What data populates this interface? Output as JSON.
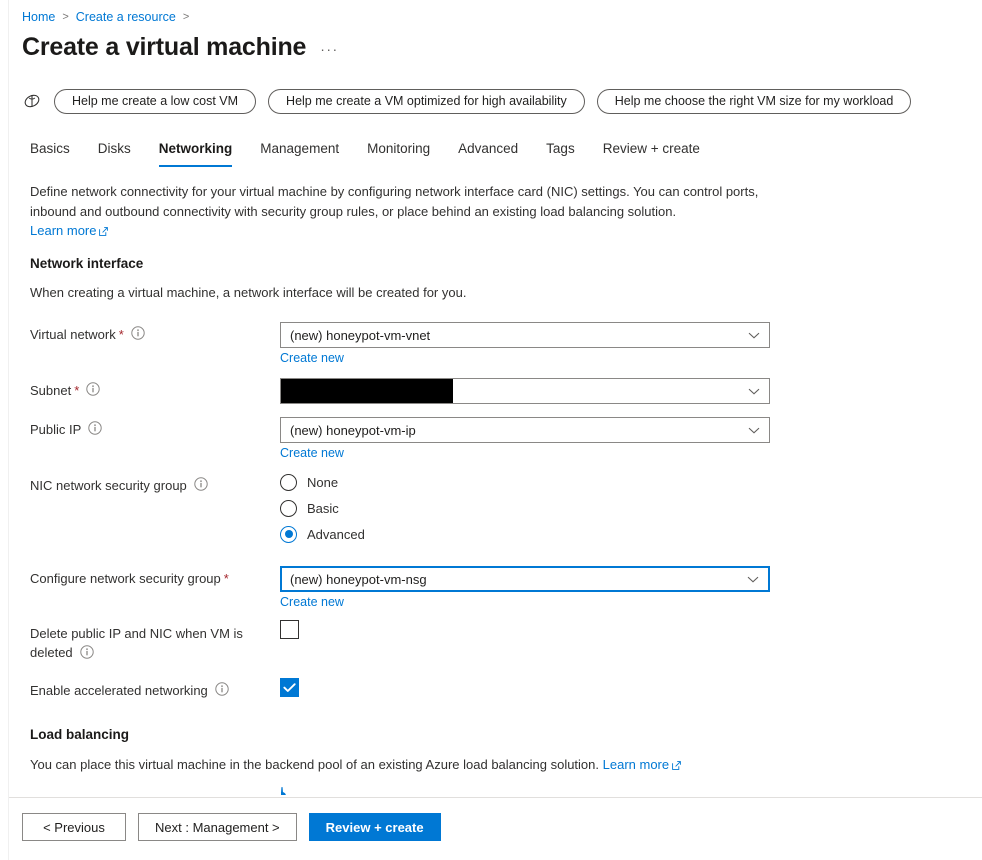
{
  "breadcrumb": {
    "items": [
      {
        "label": "Home"
      },
      {
        "label": "Create a resource"
      }
    ],
    "separator": ">"
  },
  "header": {
    "title": "Create a virtual machine",
    "ellipsis": "···"
  },
  "copilot": {
    "icon": "copilot-icon",
    "pills": [
      {
        "label": "Help me create a low cost VM"
      },
      {
        "label": "Help me create a VM optimized for high availability"
      },
      {
        "label": "Help me choose the right VM size for my workload"
      }
    ]
  },
  "tabs": [
    {
      "label": "Basics",
      "active": false
    },
    {
      "label": "Disks",
      "active": false
    },
    {
      "label": "Networking",
      "active": true
    },
    {
      "label": "Management",
      "active": false
    },
    {
      "label": "Monitoring",
      "active": false
    },
    {
      "label": "Advanced",
      "active": false
    },
    {
      "label": "Tags",
      "active": false
    },
    {
      "label": "Review + create",
      "active": false
    }
  ],
  "description": {
    "line1": "Define network connectivity for your virtual machine by configuring network interface card (NIC) settings. You can control ports,",
    "line2": "inbound and outbound connectivity with security group rules, or place behind an existing load balancing solution.",
    "learn_more": "Learn more"
  },
  "network_interface": {
    "heading": "Network interface",
    "subtext": "When creating a virtual machine, a network interface will be created for you.",
    "virtual_network": {
      "label": "Virtual network",
      "required": "*",
      "value": "(new) honeypot-vm-vnet",
      "create_new": "Create new"
    },
    "subnet": {
      "label": "Subnet",
      "required": "*",
      "value": "",
      "redacted": true
    },
    "public_ip": {
      "label": "Public IP",
      "value": "(new) honeypot-vm-ip",
      "create_new": "Create new"
    },
    "nic_nsg": {
      "label": "NIC network security group",
      "options": [
        {
          "label": "None",
          "selected": false
        },
        {
          "label": "Basic",
          "selected": false
        },
        {
          "label": "Advanced",
          "selected": true
        }
      ]
    },
    "configure_nsg": {
      "label": "Configure network security group",
      "required": "*",
      "value": "(new) honeypot-vm-nsg",
      "create_new": "Create new",
      "focused": true
    },
    "delete_public_ip": {
      "label_line1": "Delete public IP and NIC when VM is",
      "label_line2": "deleted",
      "checked": false
    },
    "accelerated_networking": {
      "label": "Enable accelerated networking",
      "checked": true
    }
  },
  "load_balancing": {
    "heading": "Load balancing",
    "subtext": "You can place this virtual machine in the backend pool of an existing Azure load balancing solution.",
    "learn_more": "Learn more"
  },
  "footer": {
    "previous": "< Previous",
    "next": "Next : Management >",
    "review": "Review + create"
  },
  "colors": {
    "accent": "#0078d4",
    "link": "#0078d4",
    "required": "#a4262c",
    "text": "#323130",
    "border": "#8a8886"
  }
}
